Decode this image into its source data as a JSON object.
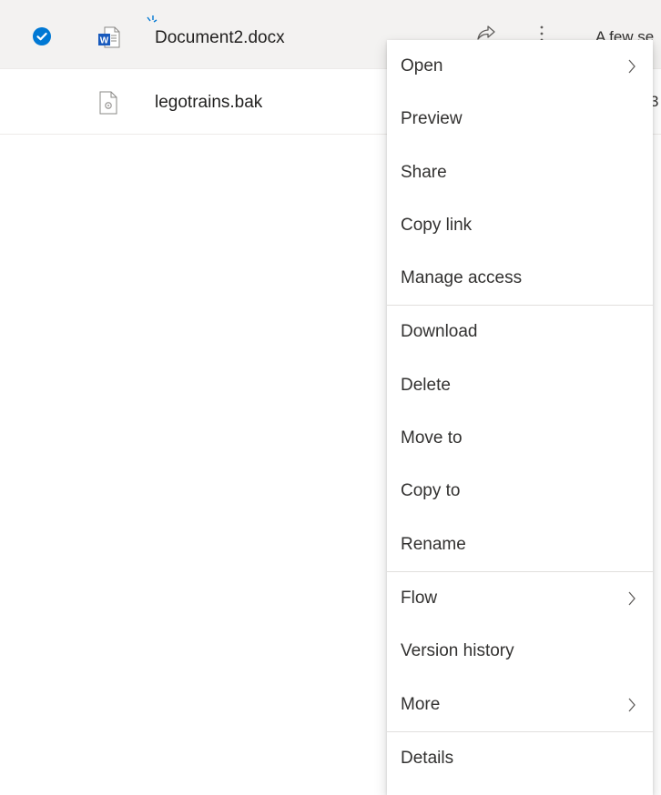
{
  "files": [
    {
      "name": "Document2.docx",
      "icon": "word-document-icon",
      "selected": true,
      "modified": "A few se"
    },
    {
      "name": "legotrains.bak",
      "icon": "generic-file-icon",
      "selected": false,
      "modified": "3"
    }
  ],
  "context_menu": {
    "groups": [
      [
        {
          "label": "Open",
          "submenu": true
        },
        {
          "label": "Preview",
          "submenu": false
        },
        {
          "label": "Share",
          "submenu": false
        },
        {
          "label": "Copy link",
          "submenu": false
        },
        {
          "label": "Manage access",
          "submenu": false
        }
      ],
      [
        {
          "label": "Download",
          "submenu": false
        },
        {
          "label": "Delete",
          "submenu": false
        },
        {
          "label": "Move to",
          "submenu": false
        },
        {
          "label": "Copy to",
          "submenu": false
        },
        {
          "label": "Rename",
          "submenu": false
        }
      ],
      [
        {
          "label": "Flow",
          "submenu": true
        },
        {
          "label": "Version history",
          "submenu": false
        },
        {
          "label": "More",
          "submenu": true
        }
      ],
      [
        {
          "label": "Details",
          "submenu": false
        }
      ]
    ]
  },
  "colors": {
    "accent": "#0078d4",
    "word_blue": "#185abd",
    "selected_row": "#f3f2f1"
  }
}
